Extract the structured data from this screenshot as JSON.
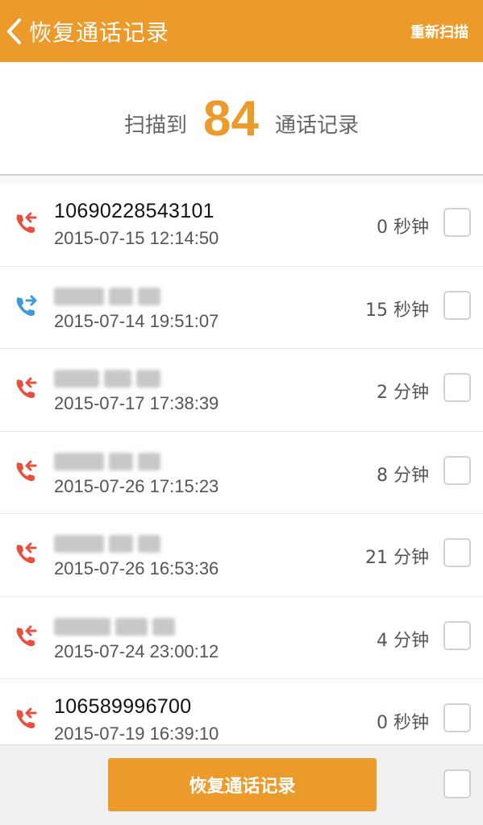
{
  "header": {
    "title": "恢复通话记录",
    "rescan_label": "重新扫描",
    "accent_color": "#ec9a2a"
  },
  "summary": {
    "prefix": "扫描到",
    "count": "84",
    "suffix": "通话记录"
  },
  "calls": [
    {
      "type": "incoming",
      "icon": "incoming-call-icon",
      "number": "10690228543101",
      "number_obscured": false,
      "time": "2015-07-15 12:14:50",
      "duration": "0 秒钟"
    },
    {
      "type": "outgoing",
      "icon": "outgoing-call-icon",
      "number": "",
      "number_obscured": true,
      "time": "2015-07-14 19:51:07",
      "duration": "15 秒钟"
    },
    {
      "type": "incoming",
      "icon": "incoming-call-icon",
      "number": "",
      "number_obscured": true,
      "time": "2015-07-17 17:38:39",
      "duration": "2 分钟"
    },
    {
      "type": "incoming",
      "icon": "incoming-call-icon",
      "number": "",
      "number_obscured": true,
      "time": "2015-07-26 17:15:23",
      "duration": "8 分钟"
    },
    {
      "type": "incoming",
      "icon": "incoming-call-icon",
      "number": "",
      "number_obscured": true,
      "time": "2015-07-26 16:53:36",
      "duration": "21 分钟"
    },
    {
      "type": "incoming",
      "icon": "incoming-call-icon",
      "number": "",
      "number_obscured": true,
      "time": "2015-07-24 23:00:12",
      "duration": "4 分钟"
    },
    {
      "type": "incoming",
      "icon": "incoming-call-icon",
      "number": "106589996700",
      "number_obscured": false,
      "time": "2015-07-19 16:39:10",
      "duration": "0 秒钟"
    }
  ],
  "bottom": {
    "restore_label": "恢复通话记录"
  },
  "colors": {
    "incoming": "#e8503e",
    "outgoing": "#3b9bdc"
  }
}
